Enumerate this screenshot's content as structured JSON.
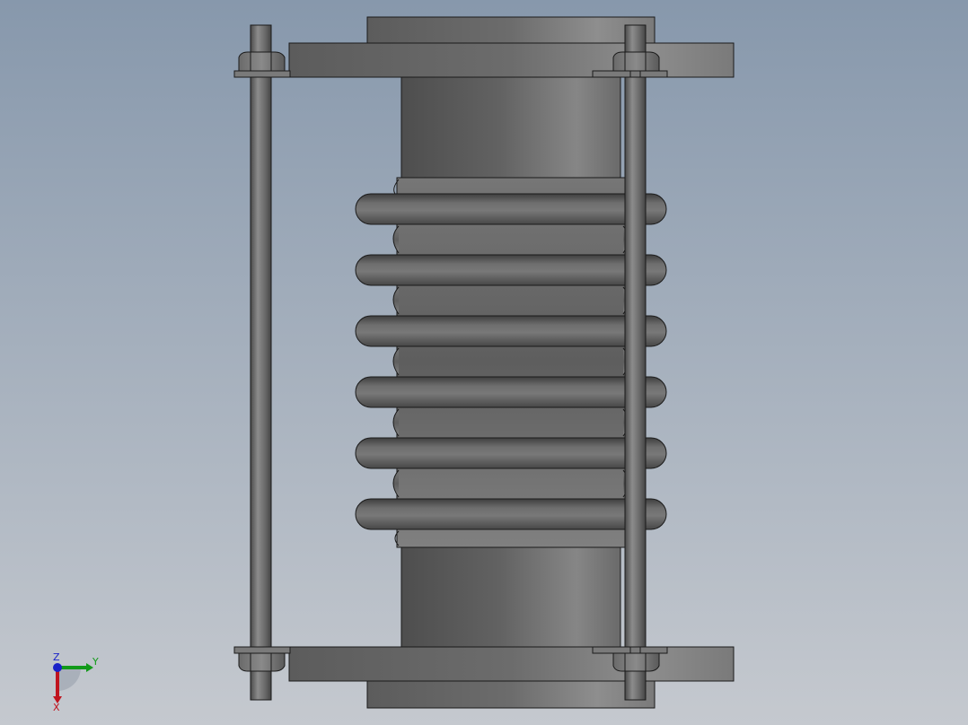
{
  "viewport": {
    "background_top": "#8798ac",
    "background_bottom": "#c5c9cf",
    "model": {
      "body_dark": "#5a5a5a",
      "body_mid": "#7a7a7a",
      "body_light": "#9a9a9a",
      "edge": "#1a1a1a"
    }
  },
  "triad": {
    "x_label": "X",
    "y_label": "Y",
    "z_label": "Z",
    "x_color": "#c0141e",
    "y_color": "#129a1a",
    "z_color": "#1a22c8"
  }
}
